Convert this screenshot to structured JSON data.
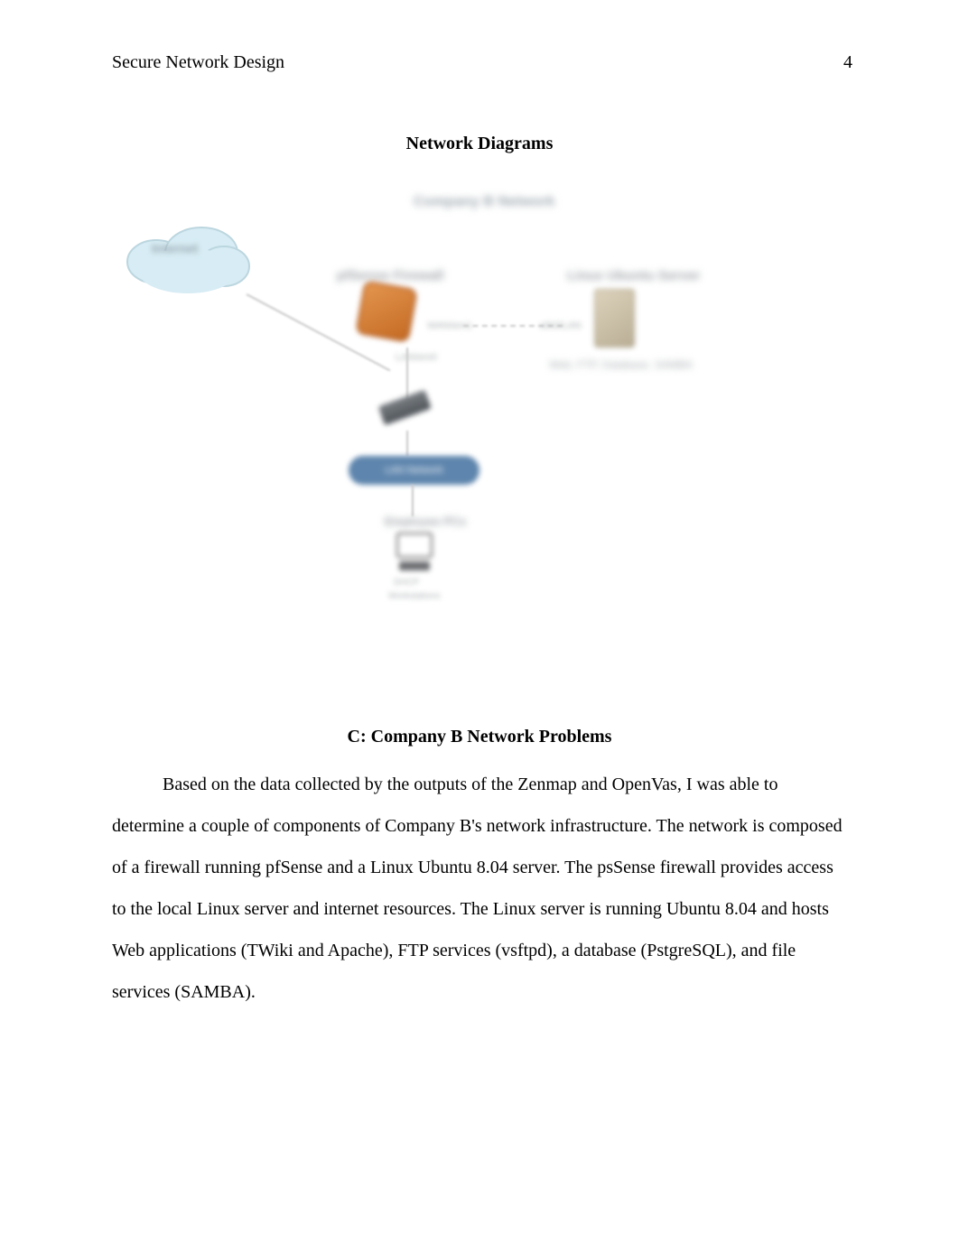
{
  "header": {
    "running_head": "Secure Network Design",
    "page_number": "4"
  },
  "headings": {
    "diagrams": "Network Diagrams",
    "section_c": "C: Company B Network Problems"
  },
  "diagram": {
    "top_label": "Company B Network",
    "cloud_label": "Internet",
    "firewall_label": "pfSense Firewall",
    "firewall_sub1": "WAN/em1",
    "firewall_sub2": "LAN/em0",
    "server_label_top": "Linux Ubuntu Server",
    "server_left": "eth0/LAN",
    "server_bottom": "Web, FTP, Database, SAMBA",
    "pill_label": "LAN Network",
    "workstation_label": "Employee PCs",
    "ws_sub1": "DHCP",
    "ws_sub2": "Workstations"
  },
  "paragraph": "Based on the data collected by the outputs of the Zenmap and OpenVas, I was able to determine a couple of components of Company B's network infrastructure. The network is composed of a firewall running pfSense and a Linux Ubuntu 8.04 server. The psSense firewall provides access to the local Linux server and internet resources. The Linux server is running Ubuntu 8.04 and hosts Web applications (TWiki and Apache), FTP services (vsftpd), a database (PstgreSQL), and file services (SAMBA)."
}
